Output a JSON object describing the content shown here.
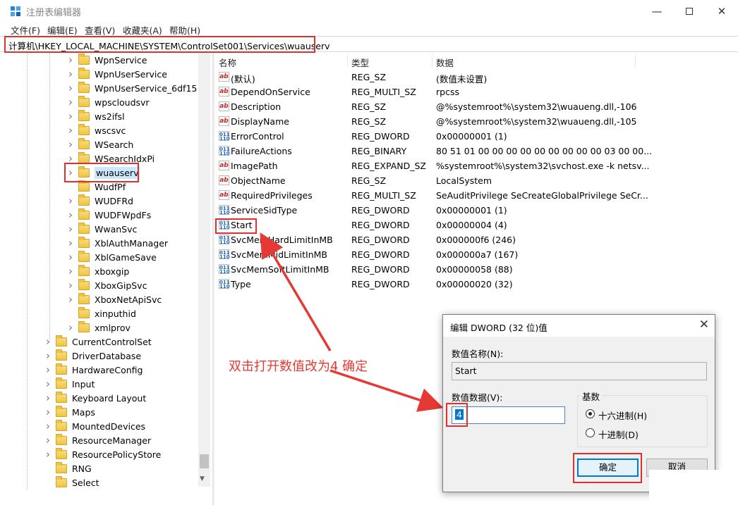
{
  "window": {
    "title": "注册表编辑器",
    "minimize_icon": "minimize-icon",
    "maximize_icon": "maximize-icon",
    "close_icon": "close-icon"
  },
  "menu": [
    "文件(F)",
    "编辑(E)",
    "查看(V)",
    "收藏夹(A)",
    "帮助(H)"
  ],
  "address": "计算机\\HKEY_LOCAL_MACHINE\\SYSTEM\\ControlSet001\\Services\\wuauserv",
  "tree": {
    "services_children": [
      {
        "label": "WpnService",
        "expandable": true
      },
      {
        "label": "WpnUserService",
        "expandable": true
      },
      {
        "label": "WpnUserService_6df15",
        "expandable": true
      },
      {
        "label": "wpscloudsvr",
        "expandable": true
      },
      {
        "label": "ws2ifsl",
        "expandable": true
      },
      {
        "label": "wscsvc",
        "expandable": true
      },
      {
        "label": "WSearch",
        "expandable": true
      },
      {
        "label": "WSearchIdxPi",
        "expandable": true
      },
      {
        "label": "wuauserv",
        "expandable": true,
        "selected": true
      },
      {
        "label": "WudfPf",
        "expandable": false
      },
      {
        "label": "WUDFRd",
        "expandable": true
      },
      {
        "label": "WUDFWpdFs",
        "expandable": true
      },
      {
        "label": "WwanSvc",
        "expandable": true
      },
      {
        "label": "XblAuthManager",
        "expandable": true
      },
      {
        "label": "XblGameSave",
        "expandable": true
      },
      {
        "label": "xboxgip",
        "expandable": true
      },
      {
        "label": "XboxGipSvc",
        "expandable": true
      },
      {
        "label": "XboxNetApiSvc",
        "expandable": true
      },
      {
        "label": "xinputhid",
        "expandable": false
      },
      {
        "label": "xmlprov",
        "expandable": true
      }
    ],
    "controlset_children": [
      {
        "label": "CurrentControlSet",
        "expandable": true
      },
      {
        "label": "DriverDatabase",
        "expandable": true
      },
      {
        "label": "HardwareConfig",
        "expandable": true
      },
      {
        "label": "Input",
        "expandable": true
      },
      {
        "label": "Keyboard Layout",
        "expandable": true
      },
      {
        "label": "Maps",
        "expandable": true
      },
      {
        "label": "MountedDevices",
        "expandable": true
      },
      {
        "label": "ResourceManager",
        "expandable": true
      },
      {
        "label": "ResourcePolicyStore",
        "expandable": true
      },
      {
        "label": "RNG",
        "expandable": false
      },
      {
        "label": "Select",
        "expandable": false
      }
    ]
  },
  "columns": {
    "name": "名称",
    "type": "类型",
    "data": "数据"
  },
  "values": [
    {
      "icon": "string-value-icon",
      "name": "(默认)",
      "type": "REG_SZ",
      "data": "(数值未设置)"
    },
    {
      "icon": "string-value-icon",
      "name": "DependOnService",
      "type": "REG_MULTI_SZ",
      "data": "rpcss"
    },
    {
      "icon": "string-value-icon",
      "name": "Description",
      "type": "REG_SZ",
      "data": "@%systemroot%\\system32\\wuaueng.dll,-106"
    },
    {
      "icon": "string-value-icon",
      "name": "DisplayName",
      "type": "REG_SZ",
      "data": "@%systemroot%\\system32\\wuaueng.dll,-105"
    },
    {
      "icon": "binary-value-icon",
      "name": "ErrorControl",
      "type": "REG_DWORD",
      "data": "0x00000001 (1)"
    },
    {
      "icon": "binary-value-icon",
      "name": "FailureActions",
      "type": "REG_BINARY",
      "data": "80 51 01 00 00 00 00 00 00 00 00 00 03 00 00..."
    },
    {
      "icon": "string-value-icon",
      "name": "ImagePath",
      "type": "REG_EXPAND_SZ",
      "data": "%systemroot%\\system32\\svchost.exe -k netsv..."
    },
    {
      "icon": "string-value-icon",
      "name": "ObjectName",
      "type": "REG_SZ",
      "data": "LocalSystem"
    },
    {
      "icon": "string-value-icon",
      "name": "RequiredPrivileges",
      "type": "REG_MULTI_SZ",
      "data": "SeAuditPrivilege SeCreateGlobalPrivilege SeCr..."
    },
    {
      "icon": "binary-value-icon",
      "name": "ServiceSidType",
      "type": "REG_DWORD",
      "data": "0x00000001 (1)"
    },
    {
      "icon": "binary-value-icon",
      "name": "Start",
      "type": "REG_DWORD",
      "data": "0x00000004 (4)"
    },
    {
      "icon": "binary-value-icon",
      "name": "SvcMemHardLimitInMB",
      "type": "REG_DWORD",
      "data": "0x000000f6 (246)"
    },
    {
      "icon": "binary-value-icon",
      "name": "SvcMemMidLimitInMB",
      "type": "REG_DWORD",
      "data": "0x000000a7 (167)"
    },
    {
      "icon": "binary-value-icon",
      "name": "SvcMemSoftLimitInMB",
      "type": "REG_DWORD",
      "data": "0x00000058 (88)"
    },
    {
      "icon": "binary-value-icon",
      "name": "Type",
      "type": "REG_DWORD",
      "data": "0x00000020 (32)"
    }
  ],
  "annotation": "双击打开数值改为4 确定",
  "dialog": {
    "title": "编辑 DWORD (32 位)值",
    "name_label": "数值名称(N):",
    "name_value": "Start",
    "data_label": "数值数据(V):",
    "data_value": "4",
    "base_label": "基数",
    "hex_label": "十六进制(H)",
    "dec_label": "十进制(D)",
    "ok_label": "确定",
    "cancel_label": "取消",
    "close_icon": "close-icon"
  },
  "colors": {
    "annotation": "#e53935",
    "selection": "#cce8ff",
    "accent": "#0078d7"
  }
}
